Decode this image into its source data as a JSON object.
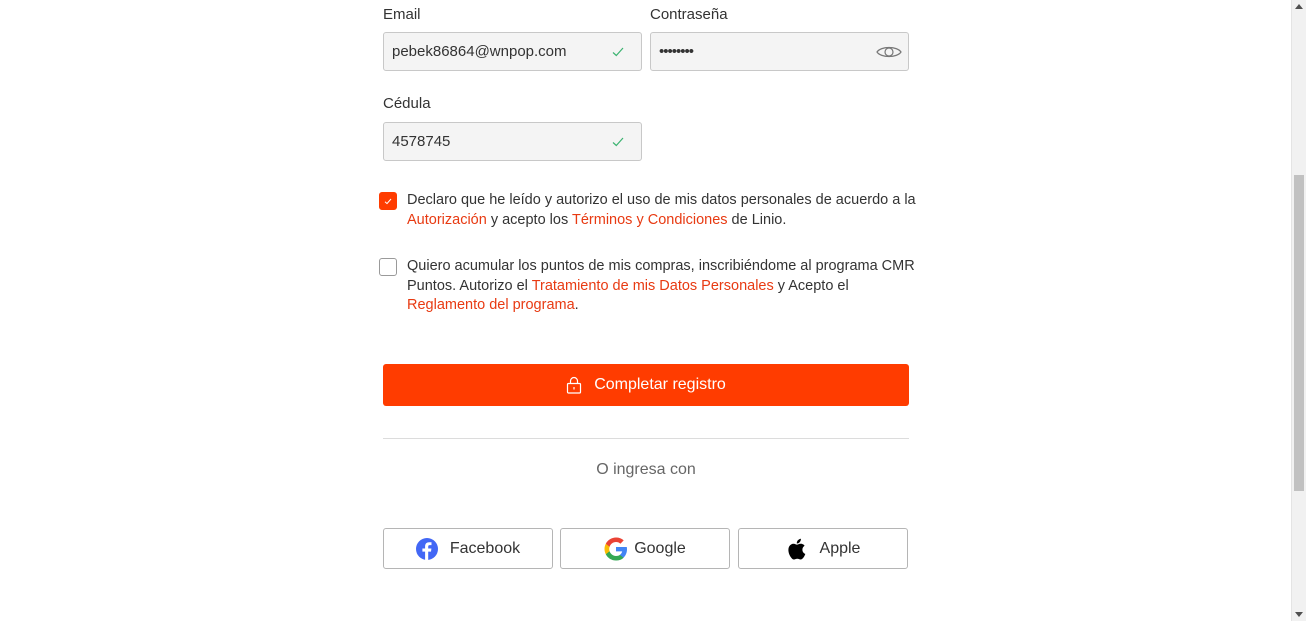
{
  "form": {
    "email": {
      "label": "Email",
      "value": "pebek86864@wnpop.com"
    },
    "password": {
      "label": "Contraseña",
      "value": "••••••••"
    },
    "cedula": {
      "label": "Cédula",
      "value": "4578745"
    }
  },
  "consent": {
    "checked": true,
    "text_1": "Declaro que he leído y autorizo el uso de mis datos personales de acuerdo a la ",
    "link_autorizacion": "Autorización",
    "text_2": " y acepto los ",
    "link_terminos": "Términos y Condiciones",
    "text_3": " de Linio."
  },
  "cmr": {
    "checked": false,
    "text_1": "Quiero acumular los puntos de mis compras, inscribiéndome al programa CMR Puntos. Autorizo el ",
    "link_tratamiento": "Tratamiento de mis Datos Personales",
    "text_2": " y Acepto el ",
    "link_reglamento": "Reglamento del programa",
    "text_3": "."
  },
  "submit_label": "Completar registro",
  "or_label": "O ingresa con",
  "social": {
    "facebook": "Facebook",
    "google": "Google",
    "apple": "Apple"
  },
  "colors": {
    "accent": "#ff3c00",
    "link": "#e83a12",
    "check_green": "#3cb371",
    "facebook_blue": "#4267f5"
  },
  "icons": [
    "check-icon",
    "eye-icon",
    "lock-icon",
    "facebook-icon",
    "google-icon",
    "apple-icon"
  ]
}
